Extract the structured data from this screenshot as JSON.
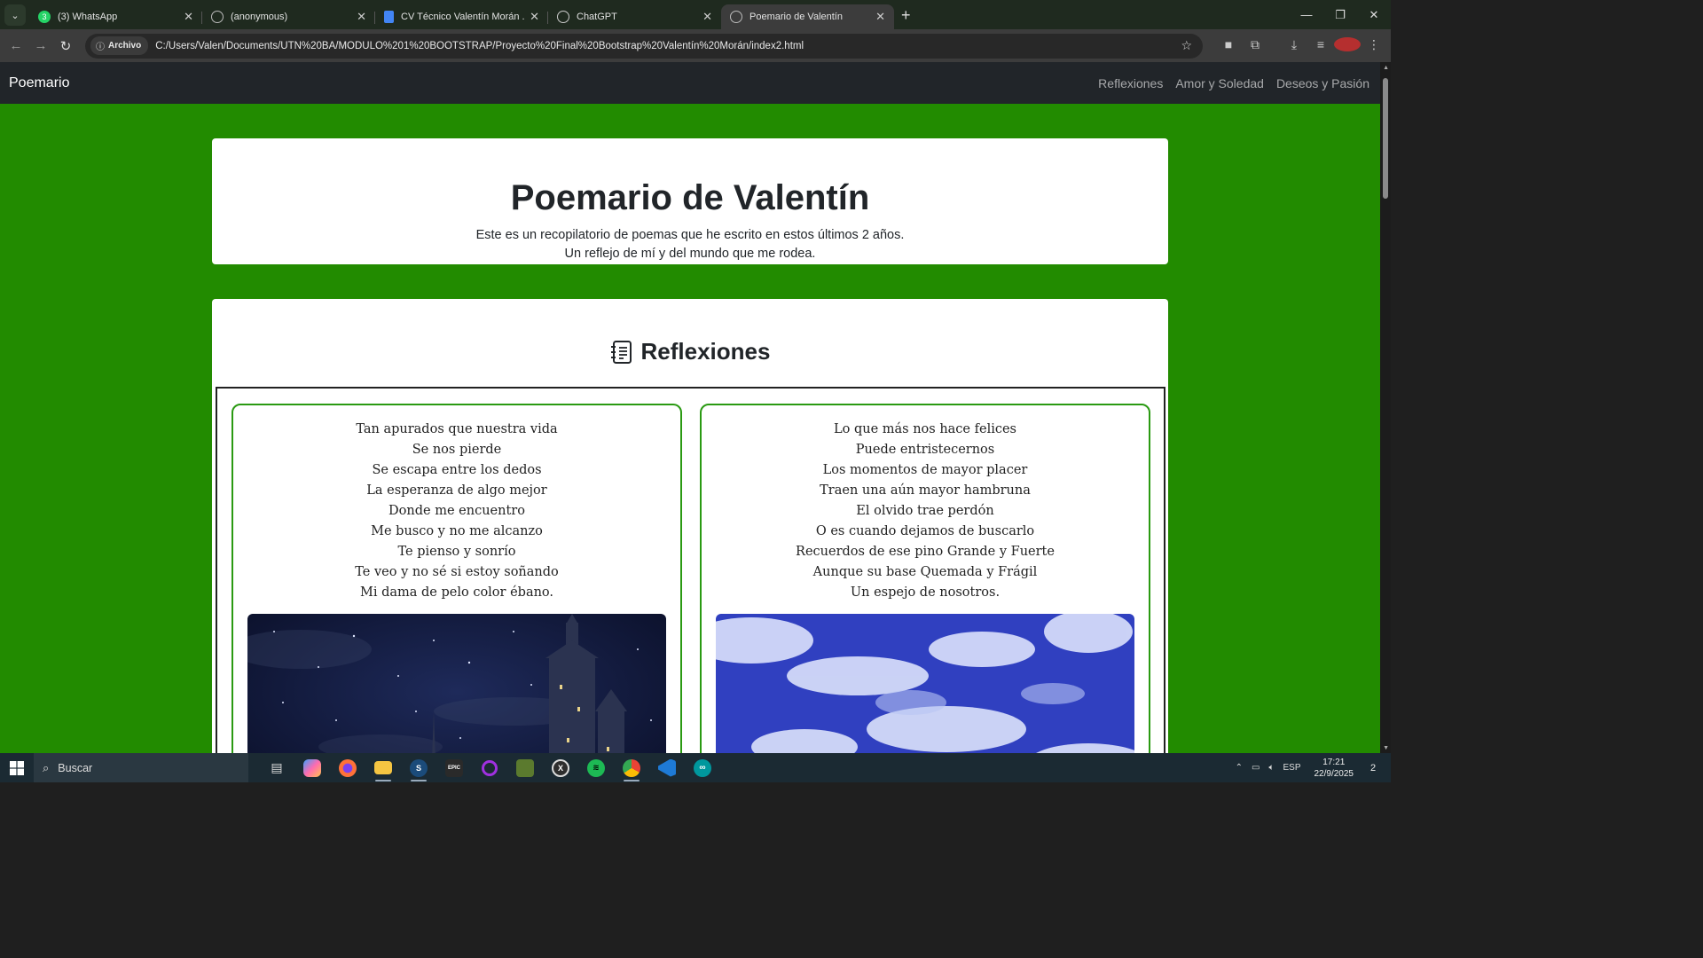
{
  "browser": {
    "tabs": [
      {
        "title": "(3) WhatsApp",
        "icon": "whatsapp-icon",
        "color": "#25d366",
        "badge": "3",
        "active": false
      },
      {
        "title": "(anonymous)",
        "icon": "globe-icon",
        "color": "#888888",
        "active": false
      },
      {
        "title": "CV Técnico Valentín Morán .doc",
        "icon": "docs-icon",
        "color": "#4285f4",
        "active": false
      },
      {
        "title": "ChatGPT",
        "icon": "chatgpt-icon",
        "color": "#cccccc",
        "active": false
      },
      {
        "title": "Poemario de Valentín",
        "icon": "globe-icon",
        "color": "#888888",
        "active": true
      }
    ],
    "security_chip": "Archivo",
    "url": "C:/Users/Valen/Documents/UTN%20BA/MODULO%201%20BOOTSTRAP/Proyecto%20Final%20Bootstrap%20Valentín%20Morán/index2.html"
  },
  "site": {
    "brand": "Poemario",
    "nav": [
      "Reflexiones",
      "Amor y Soledad",
      "Deseos y Pasión"
    ],
    "hero": {
      "title": "Poemario de Valentín",
      "line1": "Este es un recopilatorio de poemas que he escrito en estos últimos 2 años.",
      "line2": "Un reflejo de mí y del mundo que me rodea."
    },
    "section": {
      "title": "Reflexiones",
      "icon": "journal-text-icon",
      "poems": [
        {
          "lines": [
            "Tan apurados que nuestra vida",
            "Se nos pierde",
            "Se escapa entre los dedos",
            "La esperanza de algo mejor",
            "Donde me encuentro",
            "Me busco y no me alcanzo",
            "Te pienso y sonrío",
            "Te veo y no sé si estoy soñando",
            "Mi dama de pelo color ébano."
          ],
          "image": "night-castle-image"
        },
        {
          "lines": [
            "Lo que más nos hace felices",
            "Puede entristecernos",
            "Los momentos de mayor placer",
            "Traen una aún mayor hambruna",
            "El olvido trae perdón",
            "O es cuando dejamos de buscarlo",
            "Recuerdos de ese pino Grande y Fuerte",
            "Aunque su base Quemada y Frágil",
            "Un espejo de nosotros."
          ],
          "image": "cloudy-sky-image"
        }
      ]
    },
    "colors": {
      "page_bg": "#228b00",
      "navbar_bg": "#212529",
      "card_border": "#2a9a12"
    }
  },
  "taskbar": {
    "search_placeholder": "Buscar",
    "apps": [
      "task-view-icon",
      "copilot-icon",
      "firefox-icon",
      "file-explorer-icon",
      "steam-icon",
      "epic-games-icon",
      "circle-app-icon",
      "minecraft-icon",
      "xbox-icon",
      "spotify-icon",
      "chrome-icon",
      "vscode-icon",
      "arduino-icon"
    ],
    "language": "ESP",
    "time": "17:21",
    "date": "22/9/2025",
    "notifications": "2"
  }
}
